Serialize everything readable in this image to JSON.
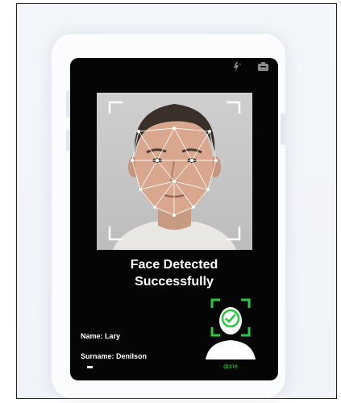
{
  "detection": {
    "caption_line1": "Face Detected",
    "caption_line2": "Successfully"
  },
  "person": {
    "name_text": "Name: Lary",
    "surname_text": "Surname: Denilson"
  },
  "badge": {
    "done_label": "done"
  },
  "status_icons": [
    "flash-auto-icon",
    "camera-switch-icon"
  ],
  "colors": {
    "screen_bg": "#050505",
    "success_green": "#27c93f",
    "scan_lines": "#ffffff"
  }
}
